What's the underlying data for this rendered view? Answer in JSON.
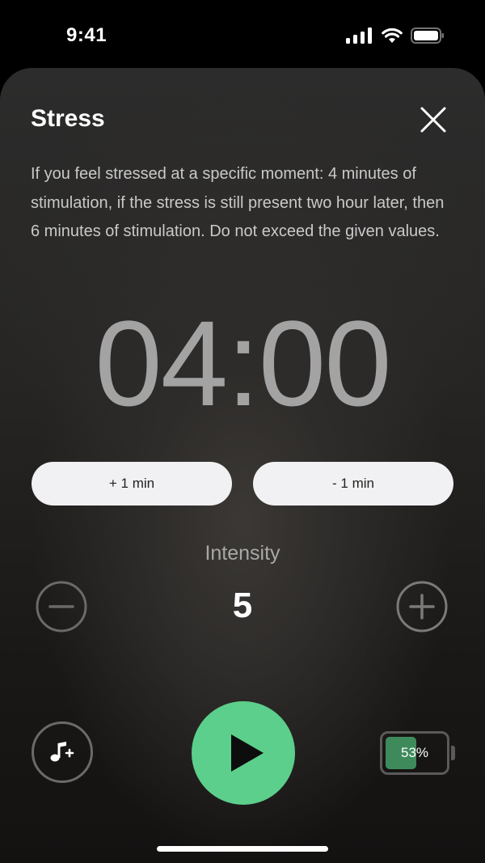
{
  "status_bar": {
    "time": "9:41",
    "icons": [
      "cellular-signal-icon",
      "wifi-icon",
      "battery-icon"
    ]
  },
  "sheet": {
    "title": "Stress",
    "close_icon": "close-icon",
    "description": "If you feel stressed at a specific moment: 4 minutes of stimulation, if the stress is still present two hour later, then 6 minutes of stimulation. Do not exceed the given values."
  },
  "timer": {
    "display": "04:00"
  },
  "time_adjust": {
    "plus_label": "+ 1 min",
    "minus_label": "- 1 min"
  },
  "intensity": {
    "label": "Intensity",
    "value": "5",
    "decrease_icon": "minus-circle-icon",
    "increase_icon": "plus-circle-icon"
  },
  "controls": {
    "music_icon": "add-music-icon",
    "play_icon": "play-icon",
    "play_color": "#5ccf8c"
  },
  "battery": {
    "percent_label": "53%",
    "level": 0.53,
    "fill_color": "#3f8a5b"
  }
}
